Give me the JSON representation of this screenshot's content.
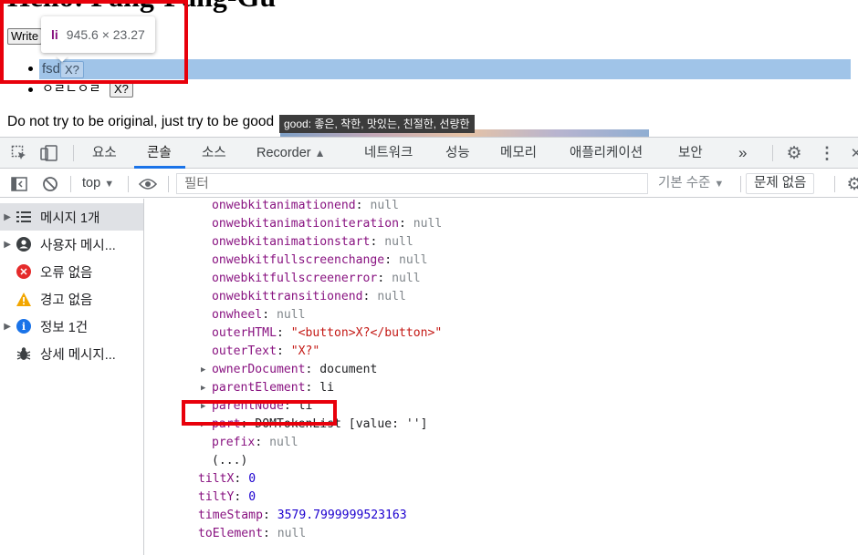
{
  "page": {
    "heading": "Hello! Pang-Pang-Gu",
    "write_button": "Write",
    "list_items": [
      {
        "text": "fsd",
        "button": "X?"
      },
      {
        "text": "ㅇㄹㄴㅇㄹ",
        "button": "X?"
      }
    ],
    "paragraph": "Do not try to be original, just try to be good",
    "tooltip": "good: 좋은, 착한, 맛있는, 친절한, 선량한"
  },
  "inspect_tooltip": {
    "tag": "li",
    "dims": "945.6 × 23.27"
  },
  "devtools": {
    "tabs": [
      "요소",
      "콘솔",
      "소스",
      "Recorder",
      "네트워크",
      "성능",
      "메모리",
      "애플리케이션",
      "보안"
    ],
    "active_tab": "콘솔",
    "more_tabs": "»",
    "toolbar": {
      "context": "top",
      "filter_placeholder": "필터",
      "log_level": "기본 수준",
      "issues": "문제 없음"
    },
    "sidebar": [
      {
        "label": "메시지 1개",
        "icon": "list-icon",
        "expandable": true,
        "selected": true
      },
      {
        "label": "사용자 메시...",
        "icon": "user-icon",
        "expandable": true,
        "selected": false
      },
      {
        "label": "오류 없음",
        "icon": "error-icon",
        "expandable": false,
        "selected": false
      },
      {
        "label": "경고 없음",
        "icon": "warning-icon",
        "expandable": false,
        "selected": false
      },
      {
        "label": "정보 1건",
        "icon": "info-icon",
        "expandable": true,
        "selected": false
      },
      {
        "label": "상세 메시지...",
        "icon": "bug-icon",
        "expandable": false,
        "selected": false
      }
    ],
    "console_rows": [
      {
        "key": "onwebkitanimationend",
        "value": "null",
        "kind": "null"
      },
      {
        "key": "onwebkitanimationiteration",
        "value": "null",
        "kind": "null"
      },
      {
        "key": "onwebkitanimationstart",
        "value": "null",
        "kind": "null"
      },
      {
        "key": "onwebkitfullscreenchange",
        "value": "null",
        "kind": "null"
      },
      {
        "key": "onwebkitfullscreenerror",
        "value": "null",
        "kind": "null"
      },
      {
        "key": "onwebkittransitionend",
        "value": "null",
        "kind": "null"
      },
      {
        "key": "onwheel",
        "value": "null",
        "kind": "null"
      },
      {
        "key": "outerHTML",
        "value": "\"<button>X?</button>\"",
        "kind": "str"
      },
      {
        "key": "outerText",
        "value": "\"X?\"",
        "kind": "str"
      },
      {
        "key": "ownerDocument",
        "value": "document",
        "kind": "obj",
        "expandable": true
      },
      {
        "key": "parentElement",
        "value": "li",
        "kind": "obj",
        "expandable": true
      },
      {
        "key": "parentNode",
        "value": "li",
        "kind": "obj",
        "expandable": true
      },
      {
        "key": "part",
        "value": "DOMTokenList [value: '']",
        "kind": "obj",
        "expandable": true
      },
      {
        "key": "prefix",
        "value": "null",
        "kind": "null"
      },
      {
        "key": "",
        "value": "(...)",
        "kind": "obj"
      },
      {
        "key": "tiltX",
        "value": "0",
        "kind": "num",
        "outdent": true
      },
      {
        "key": "tiltY",
        "value": "0",
        "kind": "num",
        "outdent": true
      },
      {
        "key": "timeStamp",
        "value": "3579.7999999523163",
        "kind": "num",
        "outdent": true
      },
      {
        "key": "toElement",
        "value": "null",
        "kind": "null",
        "outdent": true
      }
    ]
  },
  "colors": {
    "highlight": "#e8000b",
    "property_key": "#881280",
    "string_value": "#c41a16",
    "number_value": "#1c00cf",
    "active_tab": "#1a73e8"
  }
}
